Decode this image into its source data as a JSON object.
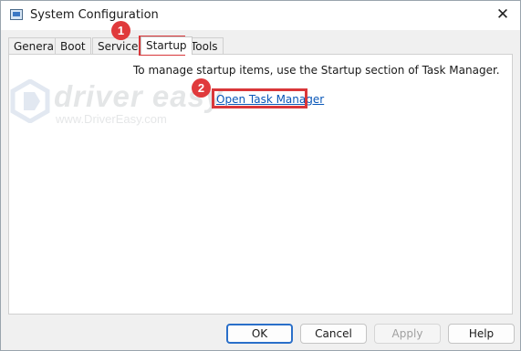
{
  "window": {
    "title": "System Configuration",
    "close_glyph": "✕"
  },
  "tabs": [
    {
      "label": "General",
      "active": false
    },
    {
      "label": "Boot",
      "active": false
    },
    {
      "label": "Services",
      "active": false
    },
    {
      "label": "Startup",
      "active": true
    },
    {
      "label": "Tools",
      "active": false
    }
  ],
  "startup": {
    "info_text": "To manage startup items, use the Startup section of Task Manager.",
    "link_text": "Open Task Manager"
  },
  "annotations": {
    "step1": "1",
    "step2": "2",
    "highlight_color": "#d9373a"
  },
  "watermark": {
    "name": "driver easy",
    "url": "www.DriverEasy.com"
  },
  "buttons": {
    "ok": "OK",
    "cancel": "Cancel",
    "apply": "Apply",
    "help": "Help"
  }
}
